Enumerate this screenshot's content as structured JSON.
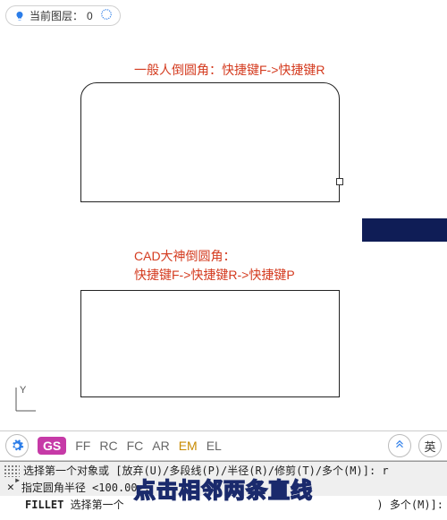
{
  "layer": {
    "label": "当前图层：",
    "value": "0"
  },
  "annotations": {
    "top": "一般人倒圆角：快捷键F->快捷键R",
    "bottom_line1": "CAD大神倒圆角：",
    "bottom_line2": "快捷键F->快捷键R->快捷键P"
  },
  "ucs_label": "Y",
  "toolbar": {
    "gs": "GS",
    "shortcuts": [
      "FF",
      "RC",
      "FC",
      "AR",
      "EM",
      "EL"
    ],
    "ime": "英"
  },
  "console": {
    "line1_prefix": "选择第一个对象或 [",
    "line1_opts": "放弃(U)/多段线(P)/半径(R)/修剪(T)/多个(M)",
    "line1_suffix": "]:",
    "line1_input": "r",
    "line2": "指定圆角半径 <100.00>:",
    "line3_cmd": "FILLET",
    "line3_text": " 选择第一个",
    "line3_tail": ") 多个(M)]:"
  },
  "caption": "点击相邻两条直线"
}
